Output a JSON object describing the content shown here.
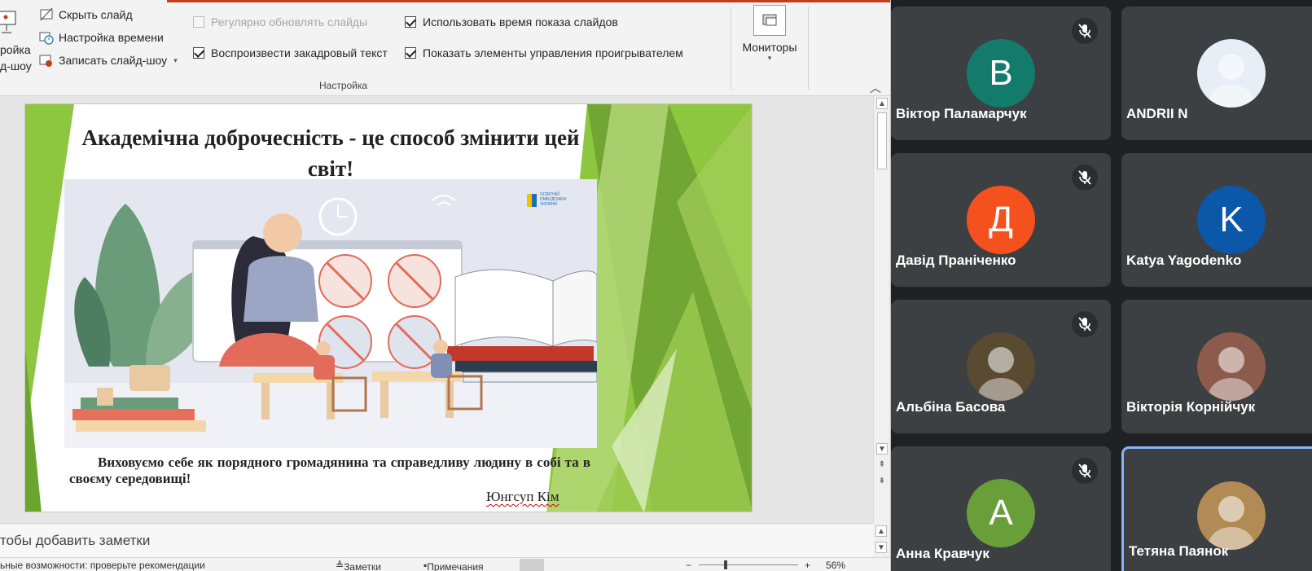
{
  "ribbon": {
    "left_partial": {
      "line1": "ройка",
      "line2": "д-шоу"
    },
    "hide_slide": "Скрыть слайд",
    "rehearse_timings": "Настройка времени",
    "record_slideshow": "Записать слайд-шоу",
    "keep_updated": "Регулярно обновлять слайды",
    "play_narrations": "Воспроизвести закадровый текст",
    "use_timings": "Использовать время показа слайдов",
    "show_media_controls": "Показать элементы управления проигрывателем",
    "group_label": "Настройка",
    "monitors": "Мониторы",
    "checkboxes": {
      "keep_updated": false,
      "play_narrations": true,
      "use_timings": true,
      "show_media_controls": true
    }
  },
  "slide": {
    "title": "Академічна доброчесність - це способ змінити цей світ!",
    "logo_text": "ОСВІТНІЙ ОМБУДСМЕН УКРАЇНИ",
    "body": "Виховуємо себе як порядного громадянина та справедливу людину в собі та в своєму середовищі!",
    "author": "Юнгсуп Кім",
    "accent_color": "#8dc63f"
  },
  "notes": {
    "placeholder": "тобы добавить заметки"
  },
  "status": {
    "accessibility": "ьные возможности: проверьте рекомендации",
    "notes": "Заметки",
    "comments": "Примечания",
    "zoom": "56%"
  },
  "meet": {
    "participants": [
      {
        "name": "Віктор Паламарчук",
        "initial": "В",
        "color": "#137b6c",
        "muted": true
      },
      {
        "name": "ANDRII N",
        "initial": "",
        "color": "#e8eef5",
        "muted": false
      },
      {
        "name": "Давід Праніченко",
        "initial": "Д",
        "color": "#f4511e",
        "muted": true
      },
      {
        "name": "Katya Yagodenko",
        "initial": "K",
        "color": "#0b57a8",
        "muted": false
      },
      {
        "name": "Альбіна Басова",
        "initial": "",
        "color": "#5a4a32",
        "muted": true
      },
      {
        "name": "Вікторія Корнійчук",
        "initial": "",
        "color": "#8d5b4c",
        "muted": false
      },
      {
        "name": "Анна Кравчук",
        "initial": "А",
        "color": "#689f38",
        "muted": true
      },
      {
        "name": "Тетяна Паянок",
        "initial": "",
        "color": "#b28a55",
        "muted": false
      }
    ]
  }
}
